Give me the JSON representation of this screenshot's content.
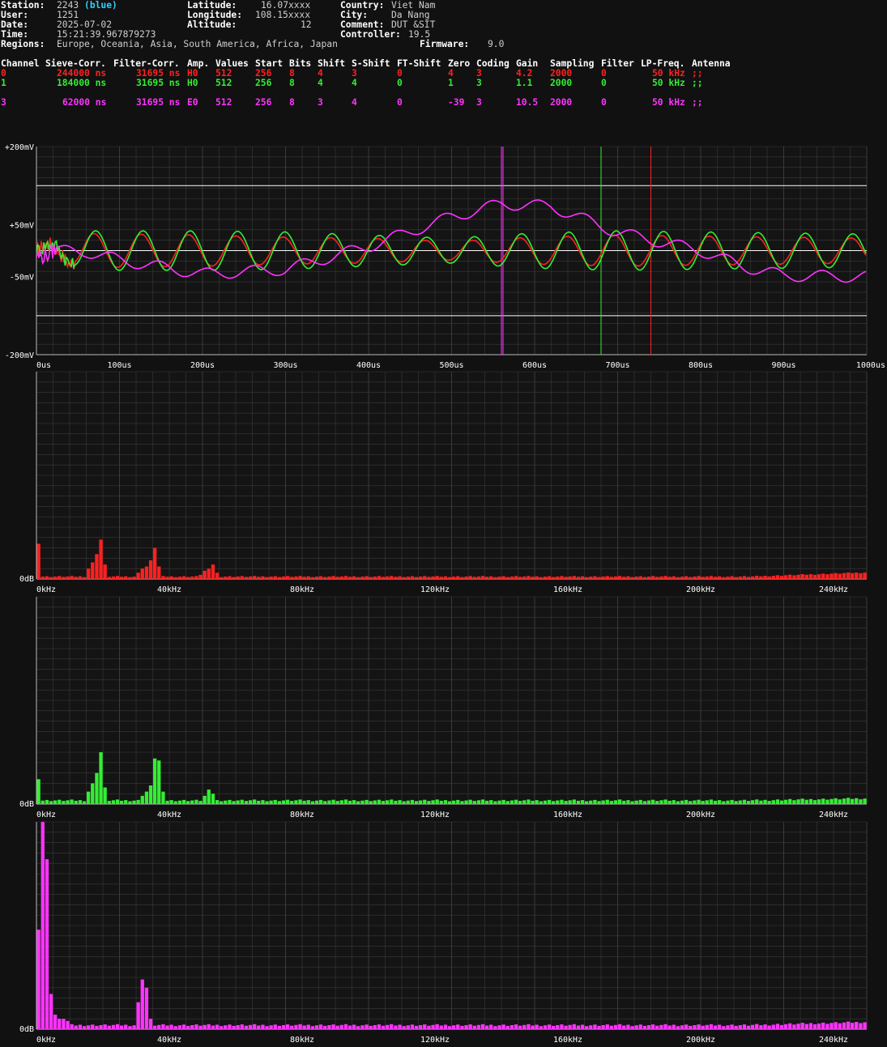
{
  "station_info": {
    "station": {
      "label": "Station:",
      "value": "2243",
      "tag": "(blue)"
    },
    "user": {
      "label": "User:",
      "value": "1251"
    },
    "date": {
      "label": "Date:",
      "value": "2025-07-02"
    },
    "time": {
      "label": "Time:",
      "value": "15:21:39.967879273"
    },
    "regions": {
      "label": "Regions:",
      "value": "Europe, Oceania, Asia, South America, Africa, Japan"
    },
    "latitude": {
      "label": "Latitude:",
      "value": "16.07xxxx"
    },
    "longitude": {
      "label": "Longitude:",
      "value": "108.15xxxx"
    },
    "altitude": {
      "label": "Altitude:",
      "value": "12"
    },
    "country": {
      "label": "Country:",
      "value": "Viet Nam"
    },
    "city": {
      "label": "City:",
      "value": "Da Nang"
    },
    "comment": {
      "label": "Comment:",
      "value": "DUT &SIT"
    },
    "controller": {
      "label": "Controller:",
      "value": "19.5"
    },
    "firmware": {
      "label": "Firmware:",
      "value": "9.0"
    }
  },
  "channel_table": {
    "headers": [
      "Channel",
      "Sieve-Corr.",
      "Filter-Corr.",
      "Amp.",
      "Values",
      "Start",
      "Bits",
      "Shift",
      "S-Shift",
      "FT-Shift",
      "Zero",
      "Coding",
      "Gain",
      "Sampling",
      "Filter",
      "LP-Freq.",
      "Antenna"
    ],
    "rows": [
      {
        "color": "#ff2020",
        "cells": [
          "0",
          "244000 ns",
          "31695 ns",
          "H0",
          "512",
          "256",
          "8",
          "4",
          "3",
          "0",
          "4",
          "3",
          "4.2",
          "2000",
          "0",
          "50 kHz",
          ";;"
        ]
      },
      {
        "color": "#33ee33",
        "cells": [
          "1",
          "184000 ns",
          "31695 ns",
          "H0",
          "512",
          "256",
          "8",
          "4",
          "4",
          "0",
          "1",
          "3",
          "1.1",
          "2000",
          "0",
          "50 kHz",
          ";;"
        ]
      },
      {
        "color": "#ff33ff",
        "cells": [
          "3",
          "62000 ns",
          "31695 ns",
          "E0",
          "512",
          "256",
          "8",
          "3",
          "4",
          "0",
          "-39",
          "3",
          "10.5",
          "2000",
          "0",
          "50 kHz",
          ";;"
        ]
      }
    ]
  },
  "colors": {
    "ch0": "#ff2020",
    "ch1": "#33ee33",
    "ch3": "#ff33ff",
    "grid": "#3a3a3a",
    "background": "#111111",
    "white": "#ffffff"
  },
  "chart_data": [
    {
      "type": "line",
      "title": "",
      "xlabel": "",
      "ylabel": "",
      "x_unit": "us",
      "y_unit": "mV",
      "xlim": [
        0,
        1000
      ],
      "ylim": [
        -200,
        200
      ],
      "x_ticks": [
        "0us",
        "100us",
        "200us",
        "300us",
        "400us",
        "500us",
        "600us",
        "700us",
        "800us",
        "900us",
        "1000us"
      ],
      "y_ticks": [
        "+200mV",
        "+50mV",
        "-50mV",
        "-200mV"
      ],
      "reference_lines_mV": [
        125,
        0,
        -125
      ],
      "markers_us": [
        {
          "x": 560,
          "color": "#ff33ff"
        },
        {
          "x": 680,
          "color": "#33ee33"
        },
        {
          "x": 740,
          "color": "#ff2020"
        }
      ],
      "grid": true,
      "series": [
        {
          "channel": "0",
          "color": "#ff2020",
          "period_us": 57,
          "phase_us": -2,
          "envelope": [
            [
              0,
              5
            ],
            [
              20,
              15
            ],
            [
              60,
              33
            ],
            [
              200,
              30
            ],
            [
              300,
              26
            ],
            [
              400,
              24
            ],
            [
              500,
              18
            ],
            [
              600,
              26
            ],
            [
              700,
              30
            ],
            [
              1000,
              24
            ]
          ],
          "start_noise_us": [
            0,
            45
          ]
        },
        {
          "channel": "1",
          "color": "#33ee33",
          "period_us": 57,
          "phase_us": 0,
          "envelope": [
            [
              0,
              5
            ],
            [
              20,
              15
            ],
            [
              60,
              38
            ],
            [
              200,
              38
            ],
            [
              300,
              36
            ],
            [
              400,
              30
            ],
            [
              500,
              24
            ],
            [
              600,
              34
            ],
            [
              700,
              38
            ],
            [
              1000,
              32
            ]
          ],
          "start_noise_us": [
            0,
            45
          ]
        },
        {
          "channel": "3",
          "color": "#ff33ff",
          "period_us": 57,
          "phase_us": 20,
          "amplitude": 11,
          "baseline": [
            [
              0,
              0
            ],
            [
              60,
              -2
            ],
            [
              100,
              -18
            ],
            [
              200,
              -45
            ],
            [
              300,
              -36
            ],
            [
              400,
              8
            ],
            [
              500,
              65
            ],
            [
              560,
              90
            ],
            [
              620,
              85
            ],
            [
              700,
              35
            ],
            [
              800,
              0
            ],
            [
              850,
              -30
            ],
            [
              900,
              -48
            ],
            [
              1000,
              -50
            ]
          ],
          "start_noise_us": [
            0,
            25
          ]
        }
      ]
    },
    {
      "type": "bar",
      "channel": "0",
      "color": "#ff2020",
      "xlim": [
        0,
        250
      ],
      "x_unit": "kHz",
      "y_baseline_label": "0dB",
      "x_ticks": [
        "0kHz",
        "40kHz",
        "80kHz",
        "120kHz",
        "160kHz",
        "200kHz",
        "240kHz"
      ],
      "peaks": [
        {
          "f": 0.5,
          "v": 0.17
        },
        {
          "f": 16,
          "v": 0.05
        },
        {
          "f": 17,
          "v": 0.08
        },
        {
          "f": 18,
          "v": 0.12
        },
        {
          "f": 19,
          "v": 0.19
        },
        {
          "f": 20,
          "v": 0.07
        },
        {
          "f": 21,
          "v": 0.04
        },
        {
          "f": 31,
          "v": 0.03
        },
        {
          "f": 32,
          "v": 0.05
        },
        {
          "f": 33,
          "v": 0.06
        },
        {
          "f": 34,
          "v": 0.09
        },
        {
          "f": 35,
          "v": 0.11
        },
        {
          "f": 36,
          "v": 0.15
        },
        {
          "f": 37,
          "v": 0.06
        },
        {
          "f": 49,
          "v": 0.02
        },
        {
          "f": 50,
          "v": 0.03
        },
        {
          "f": 51,
          "v": 0.04
        },
        {
          "f": 52,
          "v": 0.05
        },
        {
          "f": 53,
          "v": 0.07
        },
        {
          "f": 54,
          "v": 0.03
        }
      ],
      "floor": 0.012,
      "tail_rise": 0.02
    },
    {
      "type": "bar",
      "channel": "1",
      "color": "#33ee33",
      "xlim": [
        0,
        250
      ],
      "x_unit": "kHz",
      "y_baseline_label": "0dB",
      "x_ticks": [
        "0kHz",
        "40kHz",
        "80kHz",
        "120kHz",
        "160kHz",
        "200kHz",
        "240kHz"
      ],
      "peaks": [
        {
          "f": 0.5,
          "v": 0.12
        },
        {
          "f": 16,
          "v": 0.06
        },
        {
          "f": 17,
          "v": 0.1
        },
        {
          "f": 18,
          "v": 0.15
        },
        {
          "f": 19,
          "v": 0.25
        },
        {
          "f": 20,
          "v": 0.08
        },
        {
          "f": 21,
          "v": 0.04
        },
        {
          "f": 32,
          "v": 0.04
        },
        {
          "f": 33,
          "v": 0.06
        },
        {
          "f": 34,
          "v": 0.09
        },
        {
          "f": 35,
          "v": 0.14
        },
        {
          "f": 36,
          "v": 0.22
        },
        {
          "f": 37,
          "v": 0.21
        },
        {
          "f": 38,
          "v": 0.06
        },
        {
          "f": 50,
          "v": 0.03
        },
        {
          "f": 51,
          "v": 0.04
        },
        {
          "f": 52,
          "v": 0.07
        },
        {
          "f": 53,
          "v": 0.05
        }
      ],
      "floor": 0.018,
      "tail_rise": 0.01
    },
    {
      "type": "bar",
      "channel": "3",
      "color": "#ff33ff",
      "xlim": [
        0,
        250
      ],
      "x_unit": "kHz",
      "y_baseline_label": "0dB",
      "x_ticks": [
        "0kHz",
        "40kHz",
        "80kHz",
        "120kHz",
        "160kHz",
        "200kHz",
        "240kHz"
      ],
      "peaks": [
        {
          "f": 0.3,
          "v": 0.48
        },
        {
          "f": 1.5,
          "v": 1.0
        },
        {
          "f": 2.5,
          "v": 0.82
        },
        {
          "f": 3.5,
          "v": 0.18
        },
        {
          "f": 4.5,
          "v": 0.17
        },
        {
          "f": 5.5,
          "v": 0.07
        },
        {
          "f": 6.5,
          "v": 0.05
        },
        {
          "f": 7.5,
          "v": 0.05
        },
        {
          "f": 8.5,
          "v": 0.04
        },
        {
          "f": 9.5,
          "v": 0.04
        },
        {
          "f": 30,
          "v": 0.06
        },
        {
          "f": 31,
          "v": 0.13
        },
        {
          "f": 32,
          "v": 0.24
        },
        {
          "f": 33,
          "v": 0.2
        },
        {
          "f": 34,
          "v": 0.05
        }
      ],
      "floor": 0.02,
      "tail_rise": 0.015
    }
  ]
}
